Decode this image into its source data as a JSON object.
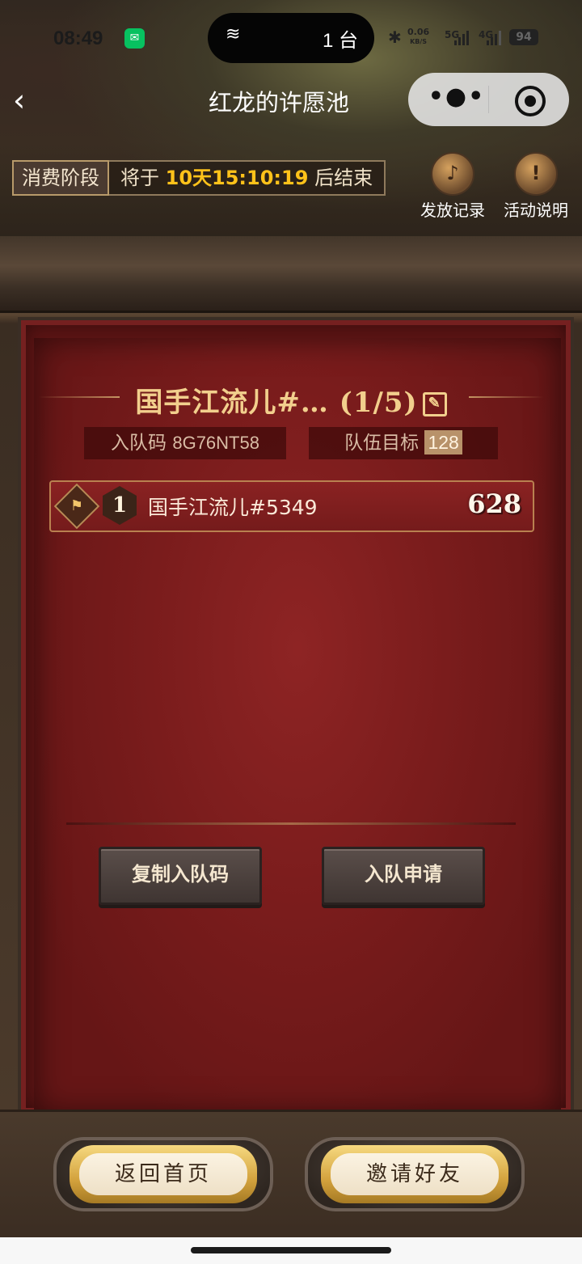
{
  "status_bar": {
    "time": "08:49",
    "island_text": "1 台",
    "net_speed_value": "0.06",
    "net_speed_unit": "KB/S",
    "signal_1": "5G",
    "signal_2": "4G",
    "battery": "94"
  },
  "nav": {
    "back": "‹",
    "title": "红龙的许愿池",
    "more": "•●•"
  },
  "phase": {
    "tag": "消费阶段",
    "prefix": "将于 ",
    "countdown": "10天15:10:19",
    "suffix": " 后结束"
  },
  "top_links": [
    {
      "label": "发放记录",
      "icon": "horn-icon"
    },
    {
      "label": "活动说明",
      "icon": "scroll-icon"
    }
  ],
  "team": {
    "title": "国手江流儿#… (1/5)",
    "code_label": "入队码",
    "code_value": "8G76NT58",
    "goal_label": "队伍目标",
    "goal_value": "128"
  },
  "members": [
    {
      "rank": "1",
      "name": "国手江流儿#5349",
      "score": "628"
    }
  ],
  "actions": {
    "copy_code": "复制入队码",
    "apply": "入队申请"
  },
  "bottom": {
    "home": "返回首页",
    "invite": "邀请好友"
  }
}
